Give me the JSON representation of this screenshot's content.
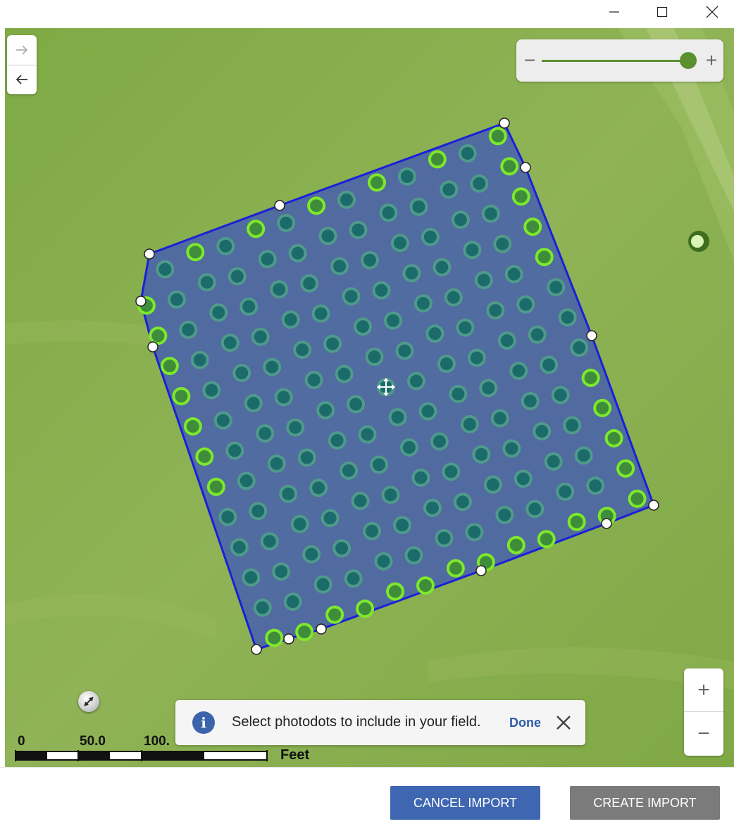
{
  "window": {
    "controls": [
      "minimize",
      "maximize",
      "close"
    ]
  },
  "map": {
    "navigation": {
      "forward_icon": "arrow-right-icon",
      "back_icon": "arrow-left-icon"
    },
    "zoom_slider": {
      "minus_label": "−",
      "plus_label": "+",
      "level": 0.98
    },
    "zoom_buttons": {
      "in_label": "+",
      "out_label": "−"
    },
    "scale_bar": {
      "labels": [
        "0",
        "50.0",
        "100."
      ],
      "unit": "Feet"
    },
    "boundary_color": "#1a20d8",
    "field_fill_color": "#4a64a8",
    "photodot_selected_color": "#7de82c",
    "photodot_color": "#1c6b6b"
  },
  "toast": {
    "icon": "info-icon",
    "message": "Select photodots to include in your field.",
    "done_label": "Done",
    "close_icon": "close-icon"
  },
  "footer": {
    "cancel_label": "CANCEL IMPORT",
    "create_label": "CREATE IMPORT"
  },
  "colors": {
    "cancel_button": "#3e66b1",
    "create_button": "#7b7b7b"
  }
}
